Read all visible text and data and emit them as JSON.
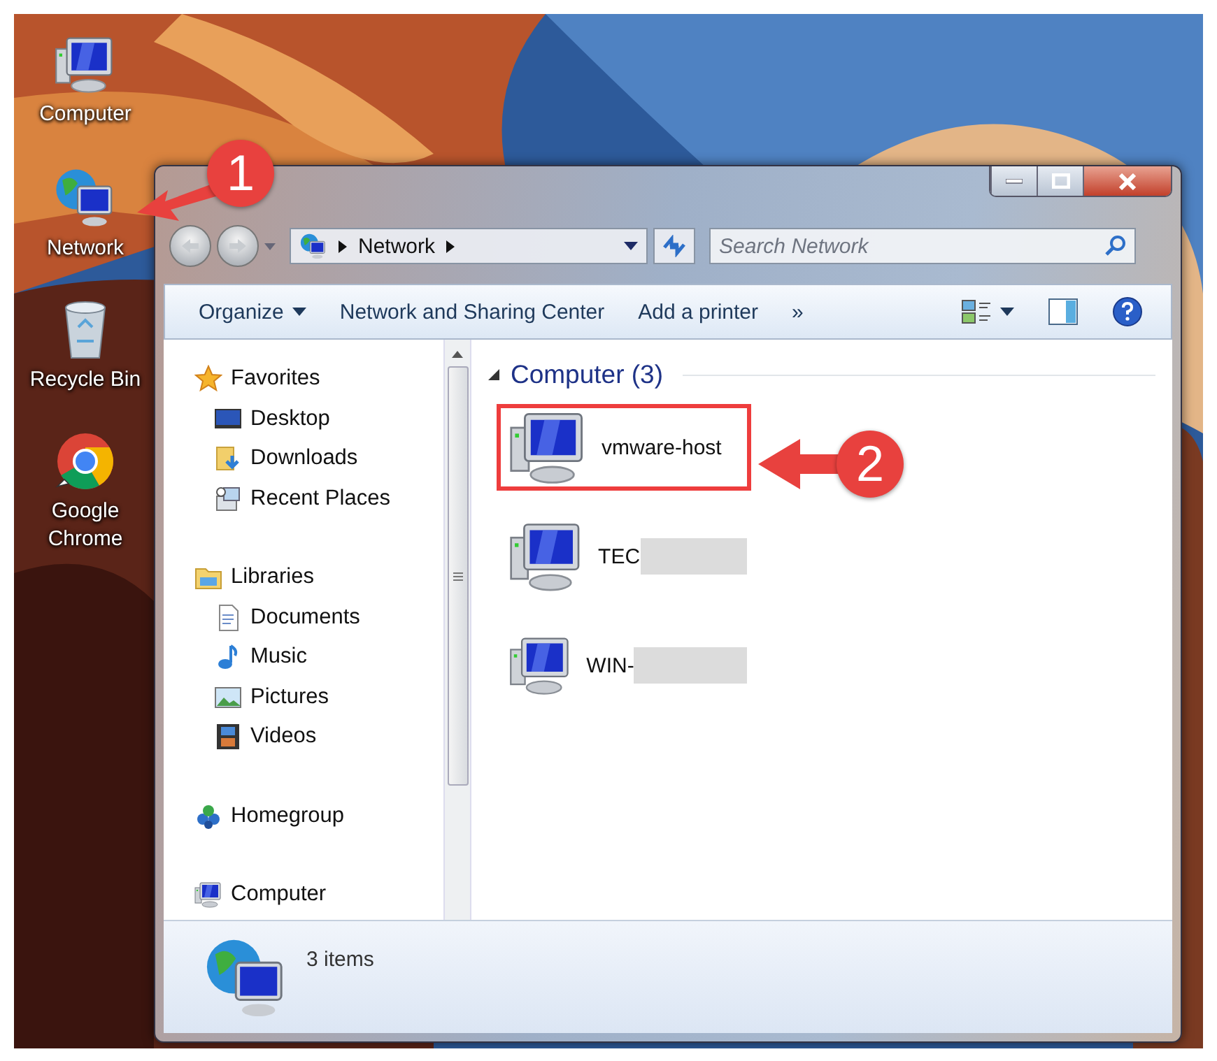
{
  "desktop_icons": [
    {
      "label": "Computer",
      "kind": "computer"
    },
    {
      "label": "Network",
      "kind": "network"
    },
    {
      "label": "Recycle Bin",
      "kind": "recycle"
    },
    {
      "label": "Google Chrome",
      "kind": "chrome"
    }
  ],
  "window": {
    "address": [
      "Network"
    ],
    "search": {
      "placeholder": "Search Network"
    },
    "toolbar": [
      {
        "label": "Organize",
        "kind": "menu"
      },
      {
        "label": "Network and Sharing Center",
        "kind": "text"
      },
      {
        "label": "Add a printer",
        "kind": "text"
      },
      {
        "label": "»",
        "kind": "text"
      },
      {
        "kind": "views"
      },
      {
        "kind": "pane"
      },
      {
        "kind": "help"
      }
    ],
    "nav": [
      {
        "label": "Favorites",
        "kind": "star",
        "children": [
          {
            "label": "Desktop",
            "kind": "desktop"
          },
          {
            "label": "Downloads",
            "kind": "downloads"
          },
          {
            "label": "Recent Places",
            "kind": "recent"
          }
        ]
      },
      {
        "label": "Libraries",
        "kind": "library",
        "children": [
          {
            "label": "Documents",
            "kind": "document"
          },
          {
            "label": "Music",
            "kind": "music"
          },
          {
            "label": "Pictures",
            "kind": "pictures"
          },
          {
            "label": "Videos",
            "kind": "videos"
          }
        ]
      },
      {
        "label": "Homegroup",
        "kind": "homegroup"
      },
      {
        "label": "Computer",
        "kind": "computer"
      }
    ],
    "group": {
      "title": "Computer (3)",
      "expanded": true,
      "items": [
        {
          "name": "vmware-host",
          "highlighted": true,
          "redacted": false
        },
        {
          "name": "TEC",
          "highlighted": false,
          "redacted": true
        },
        {
          "name": "WIN-",
          "highlighted": false,
          "redacted": true
        }
      ]
    },
    "details": {
      "text": "3 items"
    }
  },
  "callouts": [
    {
      "number": "1"
    },
    {
      "number": "2"
    }
  ]
}
